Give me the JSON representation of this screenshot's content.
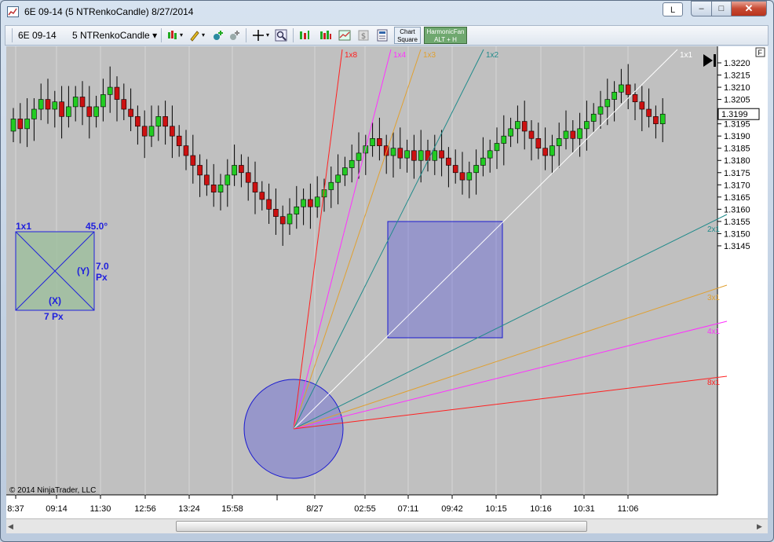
{
  "window": {
    "title": "6E 09-14 (5 NTRenkoCandle)  8/27/2014",
    "caption_button_label": "L",
    "minimize_glyph": "–",
    "maximize_glyph": "□",
    "close_glyph": "✕"
  },
  "toolbar": {
    "instrument": "6E 09-14",
    "interval": "5 NTRenkoCandle",
    "chart_square_label": "Chart Square",
    "harmonic_fan_label": "HarmonicFan ALT + H"
  },
  "chart": {
    "copyright": "© 2014 NinjaTrader, LLC",
    "f_button": "F",
    "play_glyph": "▶|",
    "up_color": "#22cc22",
    "down_color": "#cc1111",
    "background": "#c0c0c0",
    "square": {
      "title": "1x1",
      "angle": "45.0°",
      "y_axis_label": "(Y)",
      "y_value": "7.0",
      "y_unit": "Px",
      "x_axis_label": "(X)",
      "x_value": "7 Px"
    },
    "fan_labels_top": [
      {
        "label": "1x8",
        "color": "#ff2020"
      },
      {
        "label": "1x4",
        "color": "#ff30ff"
      },
      {
        "label": "1x3",
        "color": "#e0a030"
      },
      {
        "label": "1x2",
        "color": "#208a8a"
      },
      {
        "label": "1x1",
        "color": "#ffffff"
      }
    ],
    "fan_labels_right": [
      {
        "label": "2x1",
        "color": "#208a8a"
      },
      {
        "label": "3x1",
        "color": "#e0a030"
      },
      {
        "label": "4x1",
        "color": "#ff30ff"
      },
      {
        "label": "8x1",
        "color": "#ff2020"
      }
    ]
  },
  "chart_data": {
    "type": "candlestick",
    "y_axis_ticks": [
      "1.3220",
      "1.3215",
      "1.3210",
      "1.3205",
      "1.3200",
      "1.3195",
      "1.3190",
      "1.3185",
      "1.3180",
      "1.3175",
      "1.3170",
      "1.3165",
      "1.3160",
      "1.3155",
      "1.3150",
      "1.3145"
    ],
    "current_price": "1.3199",
    "x_axis_ticks": [
      "8:37",
      "09:14",
      "11:30",
      "12:56",
      "13:24",
      "15:58",
      "8/27",
      "02:55",
      "07:11",
      "09:42",
      "10:15",
      "10:16",
      "10:31",
      "11:06"
    ],
    "ylim": [
      1.3142,
      1.3224
    ],
    "candle_closes": [
      1.3197,
      1.3193,
      1.3197,
      1.3201,
      1.3205,
      1.3201,
      1.3204,
      1.3198,
      1.3202,
      1.3206,
      1.3202,
      1.3198,
      1.3202,
      1.3207,
      1.321,
      1.3205,
      1.3201,
      1.3198,
      1.3194,
      1.319,
      1.3194,
      1.3198,
      1.3194,
      1.319,
      1.3186,
      1.3182,
      1.3178,
      1.3174,
      1.317,
      1.3167,
      1.317,
      1.3174,
      1.3178,
      1.3175,
      1.3171,
      1.3167,
      1.3164,
      1.316,
      1.3157,
      1.3154,
      1.3158,
      1.3161,
      1.3164,
      1.3161,
      1.3165,
      1.3168,
      1.3171,
      1.3174,
      1.3177,
      1.318,
      1.3183,
      1.3186,
      1.3189,
      1.3186,
      1.3182,
      1.3185,
      1.3181,
      1.3184,
      1.318,
      1.3184,
      1.318,
      1.3184,
      1.3181,
      1.3178,
      1.3175,
      1.3172,
      1.3175,
      1.3178,
      1.3181,
      1.3184,
      1.3187,
      1.319,
      1.3193,
      1.3196,
      1.3192,
      1.3189,
      1.3185,
      1.3182,
      1.3186,
      1.3189,
      1.3192,
      1.3189,
      1.3193,
      1.3196,
      1.3199,
      1.3202,
      1.3205,
      1.3208,
      1.3211,
      1.3207,
      1.3204,
      1.3201,
      1.3198,
      1.3195,
      1.3199
    ],
    "fan_rays": [
      "1x8",
      "1x4",
      "1x3",
      "1x2",
      "1x1",
      "2x1",
      "3x1",
      "4x1",
      "8x1"
    ]
  }
}
